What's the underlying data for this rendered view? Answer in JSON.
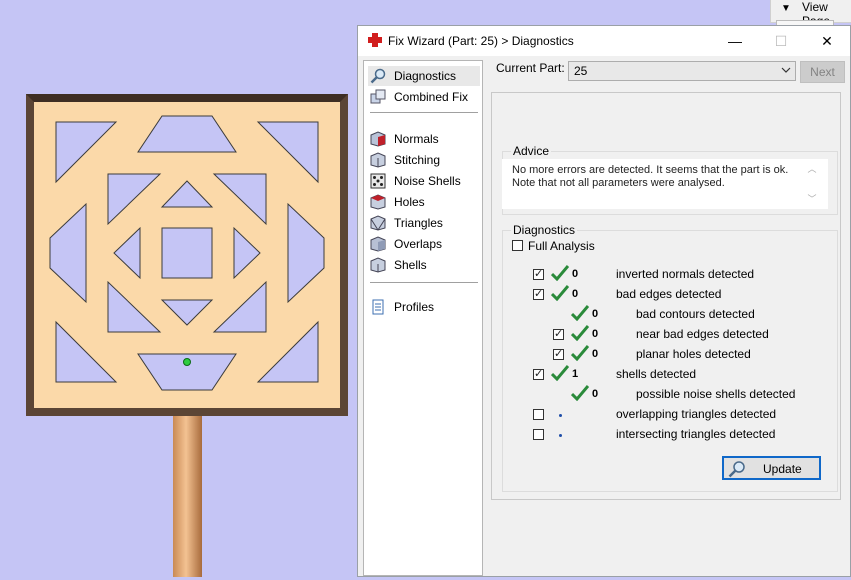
{
  "view_page": {
    "label": "View Page"
  },
  "window": {
    "title": "Fix Wizard (Part: 25) > Diagnostics",
    "minimize": "—",
    "maximize": "☐",
    "close": "✕"
  },
  "nav": {
    "items": [
      {
        "label": "Diagnostics",
        "icon": "magnifier-icon",
        "selected": true
      },
      {
        "label": "Combined Fix",
        "icon": "cubes-icon"
      },
      {
        "label": "Normals",
        "icon": "normals-cube-icon"
      },
      {
        "label": "Stitching",
        "icon": "stitching-cube-icon"
      },
      {
        "label": "Noise Shells",
        "icon": "dice-icon"
      },
      {
        "label": "Holes",
        "icon": "holes-cube-icon"
      },
      {
        "label": "Triangles",
        "icon": "triangles-cube-icon"
      },
      {
        "label": "Overlaps",
        "icon": "overlaps-cube-icon"
      },
      {
        "label": "Shells",
        "icon": "shells-cube-icon"
      },
      {
        "label": "Profiles",
        "icon": "document-icon"
      }
    ]
  },
  "current_part": {
    "label": "Current Part:",
    "value": "25",
    "next": "Next"
  },
  "advice": {
    "title": "Advice",
    "line1": "No more errors are detected. It seems that the part is ok.",
    "line2": "Note that not all parameters were analysed."
  },
  "diagnostics": {
    "title": "Diagnostics",
    "full_analysis": "Full Analysis",
    "rows": [
      {
        "count": "0",
        "label": "inverted normals detected"
      },
      {
        "count": "0",
        "label": "bad edges detected"
      },
      {
        "count": "0",
        "label": "bad contours detected"
      },
      {
        "count": "0",
        "label": "near bad edges detected"
      },
      {
        "count": "0",
        "label": "planar holes detected"
      },
      {
        "count": "1",
        "label": "shells detected"
      },
      {
        "count": "0",
        "label": "possible noise shells detected"
      },
      {
        "count": "",
        "label": "overlapping triangles detected"
      },
      {
        "count": "",
        "label": "intersecting triangles detected"
      }
    ],
    "update": "Update"
  },
  "colors": {
    "viewport_bg": "#c5c5f5",
    "frame": "#5b4535",
    "board": "#fbd9a9",
    "check_green": "#2a8a3a",
    "accent": "#0f68c9"
  }
}
